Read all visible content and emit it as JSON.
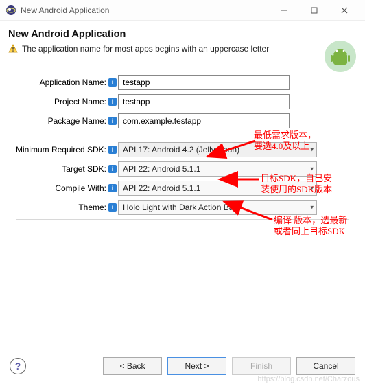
{
  "titlebar": {
    "title": "New Android Application"
  },
  "header": {
    "heading": "New Android Application",
    "warning": "The application name for most apps begins with an uppercase letter"
  },
  "form": {
    "app_name": {
      "label": "Application Name:",
      "value": "testapp"
    },
    "project_name": {
      "label": "Project Name:",
      "value": "testapp"
    },
    "package_name": {
      "label": "Package Name:",
      "value": "com.example.testapp"
    },
    "min_sdk": {
      "label": "Minimum Required SDK:",
      "value": "API 17: Android 4.2 (Jelly Bean)"
    },
    "target_sdk": {
      "label": "Target SDK:",
      "value": "API 22: Android 5.1.1"
    },
    "compile_with": {
      "label": "Compile With:",
      "value": "API 22: Android 5.1.1"
    },
    "theme": {
      "label": "Theme:",
      "value": "Holo Light with Dark Action Bar"
    }
  },
  "annotations": {
    "a1": "最低需求版本，\n要选4.0及以上",
    "a2": "目标SDK，自已安\n装使用的SDK版本",
    "a3": "编译 版本，选最新\n或者同上目标SDK"
  },
  "buttons": {
    "back": "< Back",
    "next": "Next >",
    "finish": "Finish",
    "cancel": "Cancel"
  },
  "watermark": "https://blog.csdn.net/Charzous"
}
